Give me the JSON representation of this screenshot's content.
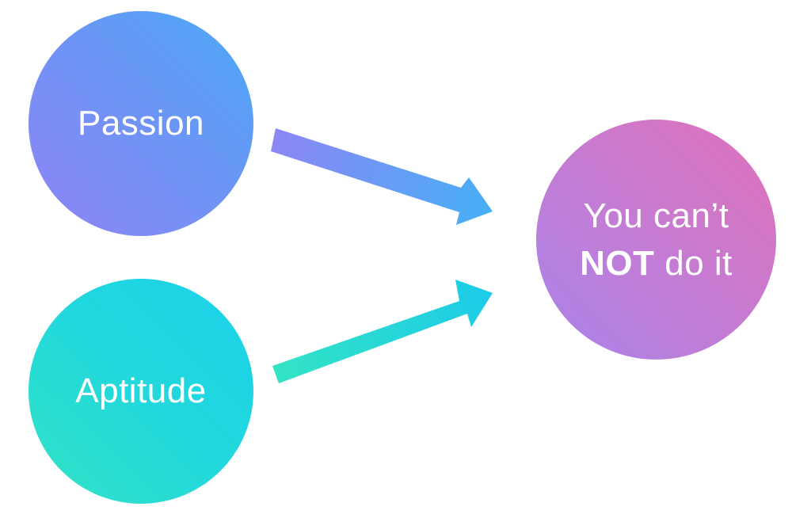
{
  "nodes": {
    "passion": {
      "label": "Passion"
    },
    "aptitude": {
      "label": "Aptitude"
    },
    "outcome": {
      "line1": "You can’t",
      "line2_bold": "NOT",
      "line2_rest": " do it"
    }
  },
  "edges": [
    {
      "from": "Passion",
      "to": "You can’t NOT do it"
    },
    {
      "from": "Aptitude",
      "to": "You can’t NOT do it"
    }
  ],
  "colors": {
    "passion": [
      "#4aa9f8",
      "#8f84f4"
    ],
    "aptitude": [
      "#1bd1ea",
      "#33e3c5"
    ],
    "outcome": [
      "#e071b8",
      "#a884ea"
    ],
    "arrow_top": [
      "#8c86f4",
      "#47b0f7"
    ],
    "arrow_bottom": [
      "#33e3c5",
      "#1ccbe8"
    ]
  }
}
